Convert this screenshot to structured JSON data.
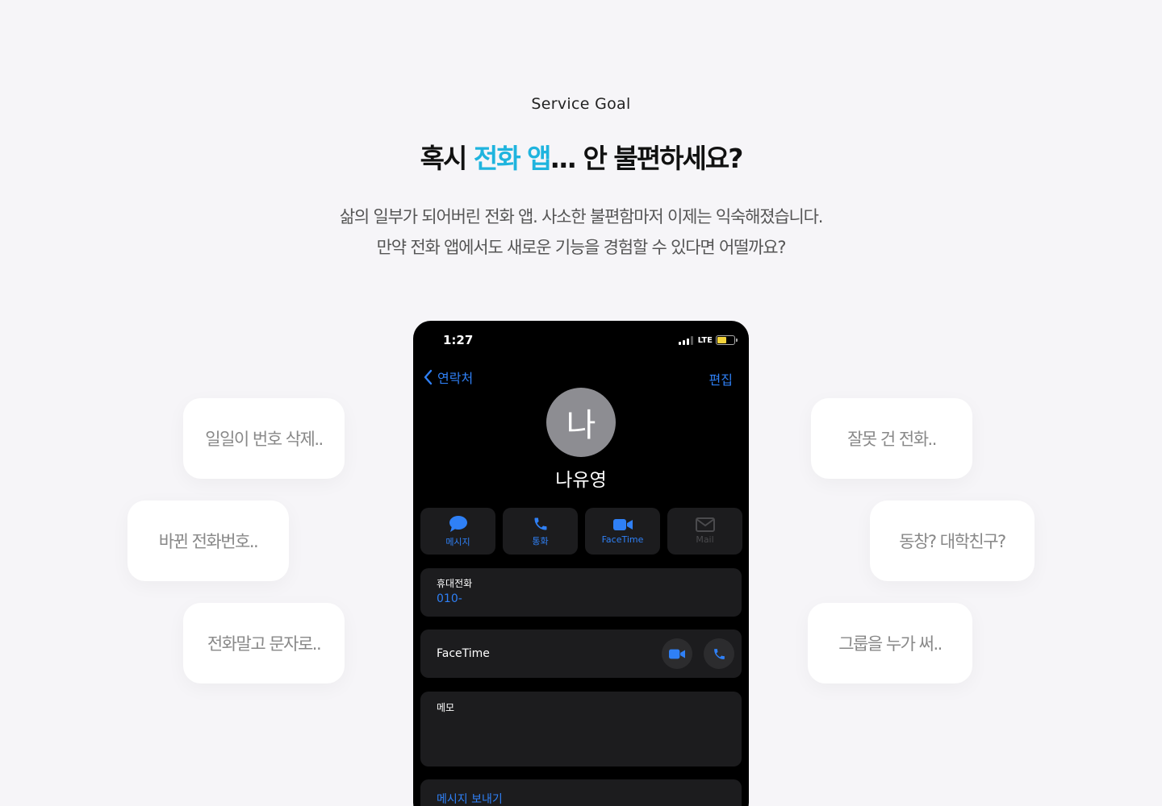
{
  "section": {
    "eyebrow": "Service Goal",
    "headline_pre": "혹시 ",
    "headline_accent": "전화 앱",
    "headline_post": "... 안 불편하세요?",
    "desc_line1": "삶의 일부가 되어버린 전화 앱. 사소한 불편함마저 이제는 익숙해졌습니다.",
    "desc_line2": "만약 전화 앱에서도 새로운 기능을 경험할 수 있다면 어떨까요?",
    "accent_color": "#1fb4de"
  },
  "bubbles": {
    "left": [
      "일일이 번호 삭제..",
      "바뀐 전화번호..",
      "전화말고 문자로.."
    ],
    "right": [
      "잘못 건 전화..",
      "동창? 대학친구?",
      "그룹을 누가 써.."
    ]
  },
  "phone": {
    "status_time": "1:27",
    "network": "LTE",
    "nav_back": "연락처",
    "nav_edit": "편집",
    "avatar_initial": "나",
    "contact_name": "나유영",
    "actions": [
      {
        "label": "메시지",
        "icon": "message-bubble-icon"
      },
      {
        "label": "통화",
        "icon": "phone-icon"
      },
      {
        "label": "FaceTime",
        "icon": "video-camera-icon"
      },
      {
        "label": "Mail",
        "icon": "envelope-icon"
      }
    ],
    "mobile_label": "휴대전화",
    "mobile_value": "010-",
    "facetime_label": "FaceTime",
    "memo_label": "메모",
    "send_message": "메시지 보내기",
    "ios_blue": "#2f80f6"
  }
}
